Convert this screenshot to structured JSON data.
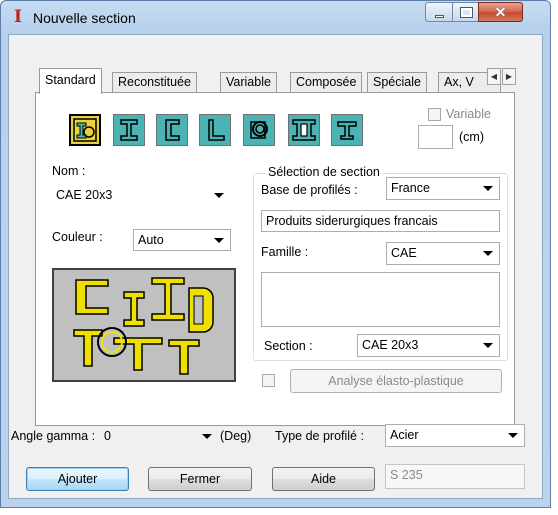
{
  "window": {
    "title": "Nouvelle section",
    "app_icon_glyph": "I",
    "close_glyph": "✕"
  },
  "tabs": {
    "items": [
      "Standard",
      "Reconstituée",
      "Variable",
      "Composée",
      "Spéciale",
      "Ax, V"
    ],
    "active": "Standard",
    "scroll_left": "◀",
    "scroll_right": "▶"
  },
  "profile_types": [
    "user-defined-profile",
    "i-beam-profile",
    "channel-profile",
    "angle-profile",
    "tube-profile",
    "double-i-profile",
    "tee-profile"
  ],
  "variable": {
    "label": "Variable",
    "unit": "(cm)"
  },
  "nom": {
    "label": "Nom :",
    "value": "CAE 20x3"
  },
  "couleur": {
    "label": "Couleur :",
    "value": "Auto"
  },
  "selection": {
    "legend": "Sélection de section",
    "base_label": "Base de profilés :",
    "base_value": "France",
    "base_description": "Produits siderurgiques francais",
    "famille_label": "Famille :",
    "famille_value": "CAE",
    "section_label": "Section :",
    "section_value": "CAE 20x3"
  },
  "analyse": {
    "label": "Analyse élasto-plastique"
  },
  "angle": {
    "label": "Angle gamma :",
    "value": "0",
    "unit": "(Deg)"
  },
  "type_profile": {
    "label": "Type de profilé :",
    "value": "Acier"
  },
  "material_grade": "S 235",
  "buttons": {
    "add": "Ajouter",
    "close": "Fermer",
    "help": "Aide"
  },
  "colors": {
    "profile_teal": "#4bb3b3",
    "profile_yellow": "#e9d23a",
    "preview_bg": "#c0c0c0",
    "preview_fill": "#f0e000"
  }
}
